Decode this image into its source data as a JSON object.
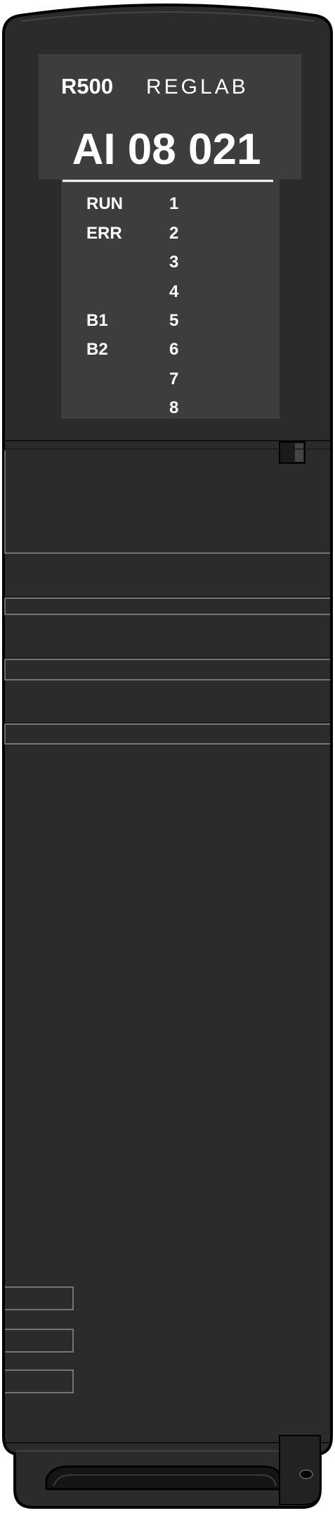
{
  "module": {
    "series": "R500",
    "brand": "REGLAB",
    "model_code": "AI 08 021",
    "status_indicators": [
      "RUN",
      "ERR",
      "",
      "",
      "B1",
      "B2",
      "",
      ""
    ],
    "channel_indicators": [
      "1",
      "2",
      "3",
      "4",
      "5",
      "6",
      "7",
      "8"
    ]
  },
  "colors": {
    "body": "#2b2b2b",
    "outline": "#000000",
    "label_panel": "#3d3d3d",
    "text": "#ffffff",
    "groove_line": "#8c8c8c"
  }
}
